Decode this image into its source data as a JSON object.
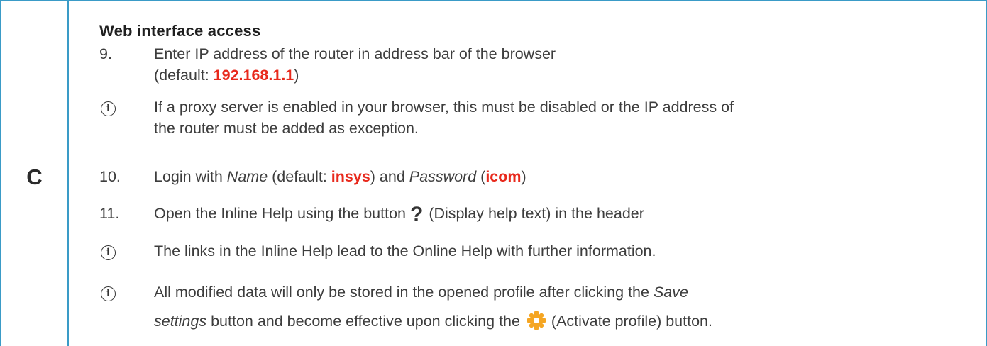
{
  "step": "C",
  "heading": "Web interface access",
  "items": [
    {
      "marker": "9.",
      "lines": [
        "Enter IP address of the router in address bar of the browser",
        "(default: ",
        "192.168.1.1",
        ")"
      ]
    },
    {
      "marker": "info-icon",
      "text_line1": "If a proxy server is enabled in your browser, this must be disabled or the IP address of",
      "text_line2": "the router must be added as exception."
    },
    {
      "marker": "10.",
      "pre": "Login with ",
      "name_label": "Name",
      "mid1": " (default: ",
      "name_value": "insys",
      "mid2": ") and ",
      "password_label": "Password",
      "mid3": " (",
      "password_value": "icom",
      "post": ")"
    },
    {
      "marker": "11.",
      "pre": "Open the Inline Help using the button",
      "button_glyph": "?",
      "post": "(Display help text) in the header"
    },
    {
      "marker": "info-icon",
      "text": "The links in the Inline Help lead to the Online Help with further information."
    },
    {
      "marker": "info-icon",
      "line1_pre": "All modified data will only be stored in the opened profile after clicking the ",
      "line1_em": "Save",
      "line2_em": "settings",
      "line2_mid": " button and become effective upon clicking the ",
      "line2_post": " (Activate profile) button."
    }
  ],
  "info_glyph": "i",
  "colors": {
    "border": "#3a9bc7",
    "highlight": "#e8291c",
    "gear": "#f5a623"
  }
}
